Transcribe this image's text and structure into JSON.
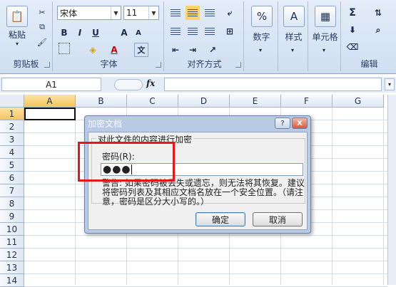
{
  "ribbon": {
    "clipboard": {
      "label": "剪贴板",
      "paste": "粘贴"
    },
    "font": {
      "label": "字体",
      "font_name": "宋体",
      "font_size": "11",
      "bold": "B",
      "italic": "I",
      "underline": "U",
      "grow": "A",
      "shrink": "A",
      "fontcolor": "A",
      "phonetic": "文"
    },
    "align": {
      "label": "对齐方式"
    },
    "number": {
      "label": "数字",
      "percent": "%"
    },
    "styles": {
      "label": "样式"
    },
    "cells": {
      "label": "单元格"
    },
    "editing": {
      "label": "编辑",
      "sigma": "Σ"
    }
  },
  "formula_bar": {
    "name_box": "A1",
    "fx": "fx",
    "value": ""
  },
  "grid": {
    "columns": [
      "A",
      "B",
      "C",
      "D",
      "E",
      "F",
      "G"
    ],
    "rows": [
      "1",
      "2",
      "3",
      "4",
      "5",
      "6",
      "7",
      "8",
      "9",
      "10",
      "11",
      "12",
      "13",
      "14"
    ],
    "active_cell": "A1"
  },
  "dialog": {
    "title": "加密文档",
    "help": "?",
    "close": "X",
    "group_title": "对此文件的内容进行加密",
    "password_label": "密码(R):",
    "password_value": "●●●",
    "warning": "警告: 如果密码被丢失或遗忘，则无法将其恢复。建议将密码列表及其相应文档名放在一个安全位置。（请注意，密码是区分大小写的。）",
    "ok": "确定",
    "cancel": "取消"
  },
  "colors": {
    "highlight": "#e4171b",
    "ribbon": "#dbe6f4",
    "selected_header": "#f5c45f"
  }
}
